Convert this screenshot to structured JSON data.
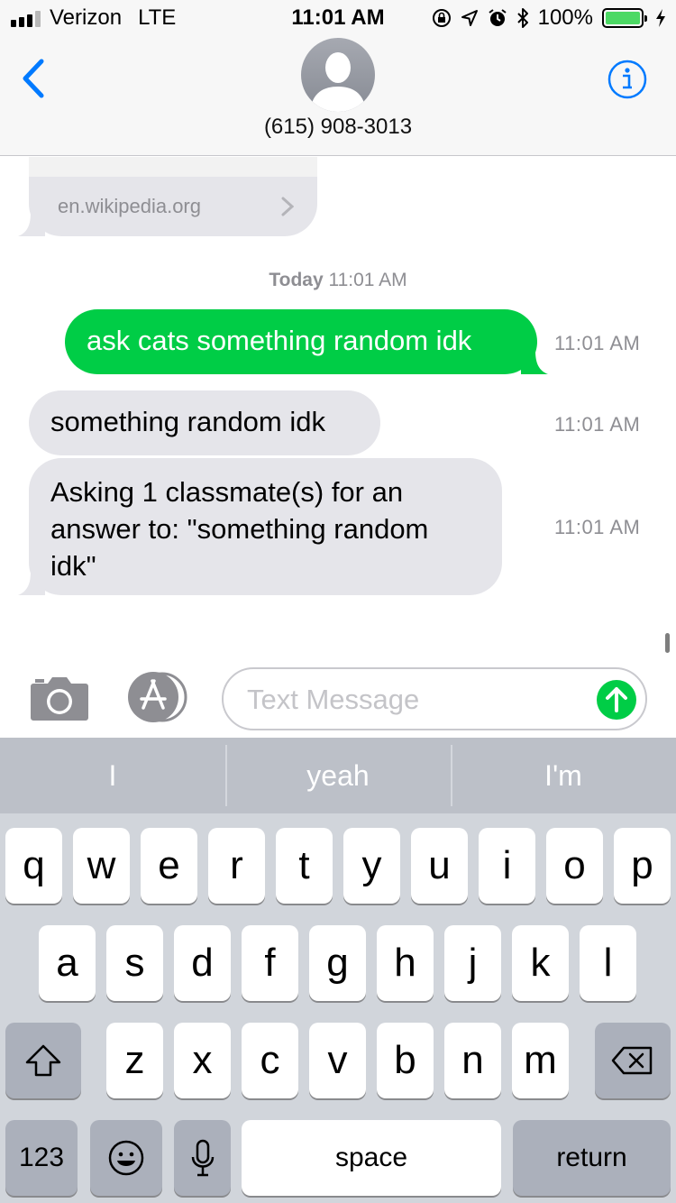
{
  "status_bar": {
    "carrier": "Verizon",
    "network": "LTE",
    "time": "11:01 AM",
    "battery": "100%",
    "icons": [
      "signal-bars",
      "orientation-lock-icon",
      "location-arrow-icon",
      "alarm-icon",
      "bluetooth-icon",
      "battery-icon",
      "charging-bolt-icon"
    ]
  },
  "nav": {
    "back_icon": "chevron-left-icon",
    "contact": "(615) 908-3013",
    "info_icon": "info-circle-icon"
  },
  "conversation": {
    "link_preview": {
      "domain": "en.wikipedia.org"
    },
    "date_header": {
      "day": "Today",
      "time": "11:01 AM"
    },
    "messages": [
      {
        "direction": "sent",
        "text": "ask cats something random idk",
        "time": "11:01 AM"
      },
      {
        "direction": "received",
        "text": "something random idk",
        "time": "11:01 AM"
      },
      {
        "direction": "received",
        "lines": [
          "Asking 1 classmate(s) for an",
          "answer to: \"something random",
          "idk\""
        ],
        "time": "11:01 AM"
      }
    ]
  },
  "composer": {
    "placeholder": "Text Message",
    "value": "",
    "camera_icon": "camera-icon",
    "apps_icon": "app-store-icon",
    "send_icon": "arrow-up-icon",
    "accent": "#00cd46"
  },
  "keyboard": {
    "suggestions": [
      "I",
      "yeah",
      "I'm"
    ],
    "row1": [
      "q",
      "w",
      "e",
      "r",
      "t",
      "y",
      "u",
      "i",
      "o",
      "p"
    ],
    "row2": [
      "a",
      "s",
      "d",
      "f",
      "g",
      "h",
      "j",
      "k",
      "l"
    ],
    "row3": [
      "z",
      "x",
      "c",
      "v",
      "b",
      "n",
      "m"
    ],
    "numbers_key": "123",
    "space_key": "space",
    "return_key": "return",
    "shift_icon": "shift-icon",
    "delete_icon": "delete-icon",
    "emoji_icon": "emoji-icon",
    "mic_icon": "microphone-icon"
  }
}
